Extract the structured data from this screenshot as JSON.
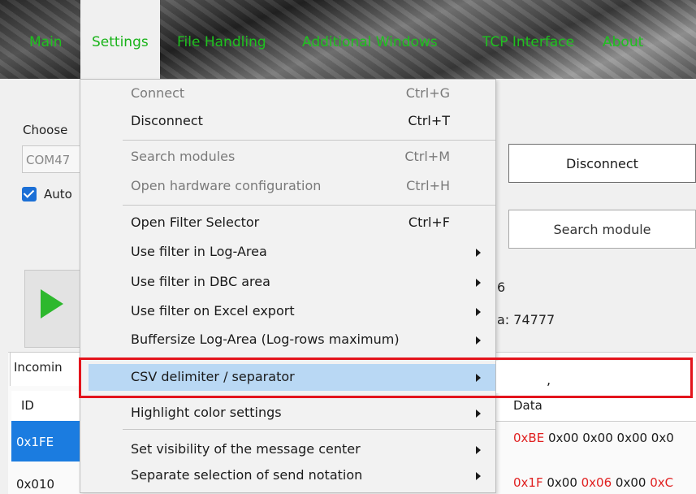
{
  "nav": {
    "items": [
      {
        "label": "Main"
      },
      {
        "label": "Settings",
        "active": true
      },
      {
        "label": "File Handling"
      },
      {
        "label": "Additional Windows"
      },
      {
        "label": "TCP Interface"
      },
      {
        "label": "About"
      }
    ]
  },
  "connection": {
    "choose_label": "Choose",
    "port_value": "COM47",
    "auto_label": "Auto",
    "disconnect_button": "Disconnect",
    "search_module_button": "Search module",
    "count_fragment": "6",
    "a_fragment": "a: 74777"
  },
  "tabs": {
    "incoming": "Incomin"
  },
  "table": {
    "headers": {
      "id": "ID",
      "data": "Data"
    },
    "rows": [
      {
        "id": "0x1FE",
        "data_red": "0xBE",
        "data_rest": " 0x00 0x00 0x00 0x0"
      },
      {
        "id": "0x010",
        "data_red": "0x1F",
        "data_rest": " 0x00 ",
        "data_red2": "0x06",
        "data_rest2": " 0x00 ",
        "data_red3": "0xC"
      }
    ]
  },
  "menu": {
    "items": [
      {
        "label": "Connect",
        "shortcut": "Ctrl+G",
        "disabled": true
      },
      {
        "label": "Disconnect",
        "shortcut": "Ctrl+T"
      },
      {
        "label": "Search modules",
        "shortcut": "Ctrl+M",
        "disabled": true
      },
      {
        "label": "Open hardware configuration",
        "shortcut": "Ctrl+H",
        "disabled": true
      },
      {
        "label": "Open Filter Selector",
        "shortcut": "Ctrl+F"
      },
      {
        "label": "Use filter in Log-Area",
        "submenu": true
      },
      {
        "label": "Use filter in DBC area",
        "submenu": true
      },
      {
        "label": "Use filter on Excel export",
        "submenu": true
      },
      {
        "label": "Buffersize Log-Area (Log-rows maximum)",
        "submenu": true
      },
      {
        "label": "CSV delimiter / separator",
        "submenu": true,
        "highlighted": true
      },
      {
        "label": "Highlight color settings",
        "submenu": true
      },
      {
        "label": "Set visibility of the message center",
        "submenu": true
      },
      {
        "label": "Separate selection of send notation",
        "submenu": true
      }
    ]
  },
  "submenu": {
    "value": ","
  },
  "colors": {
    "nav_text": "#1ec21e",
    "highlight": "#b9d8f4",
    "selection": "#1b7ce0",
    "annotation": "#e3141c",
    "hex_red": "#e02020"
  }
}
